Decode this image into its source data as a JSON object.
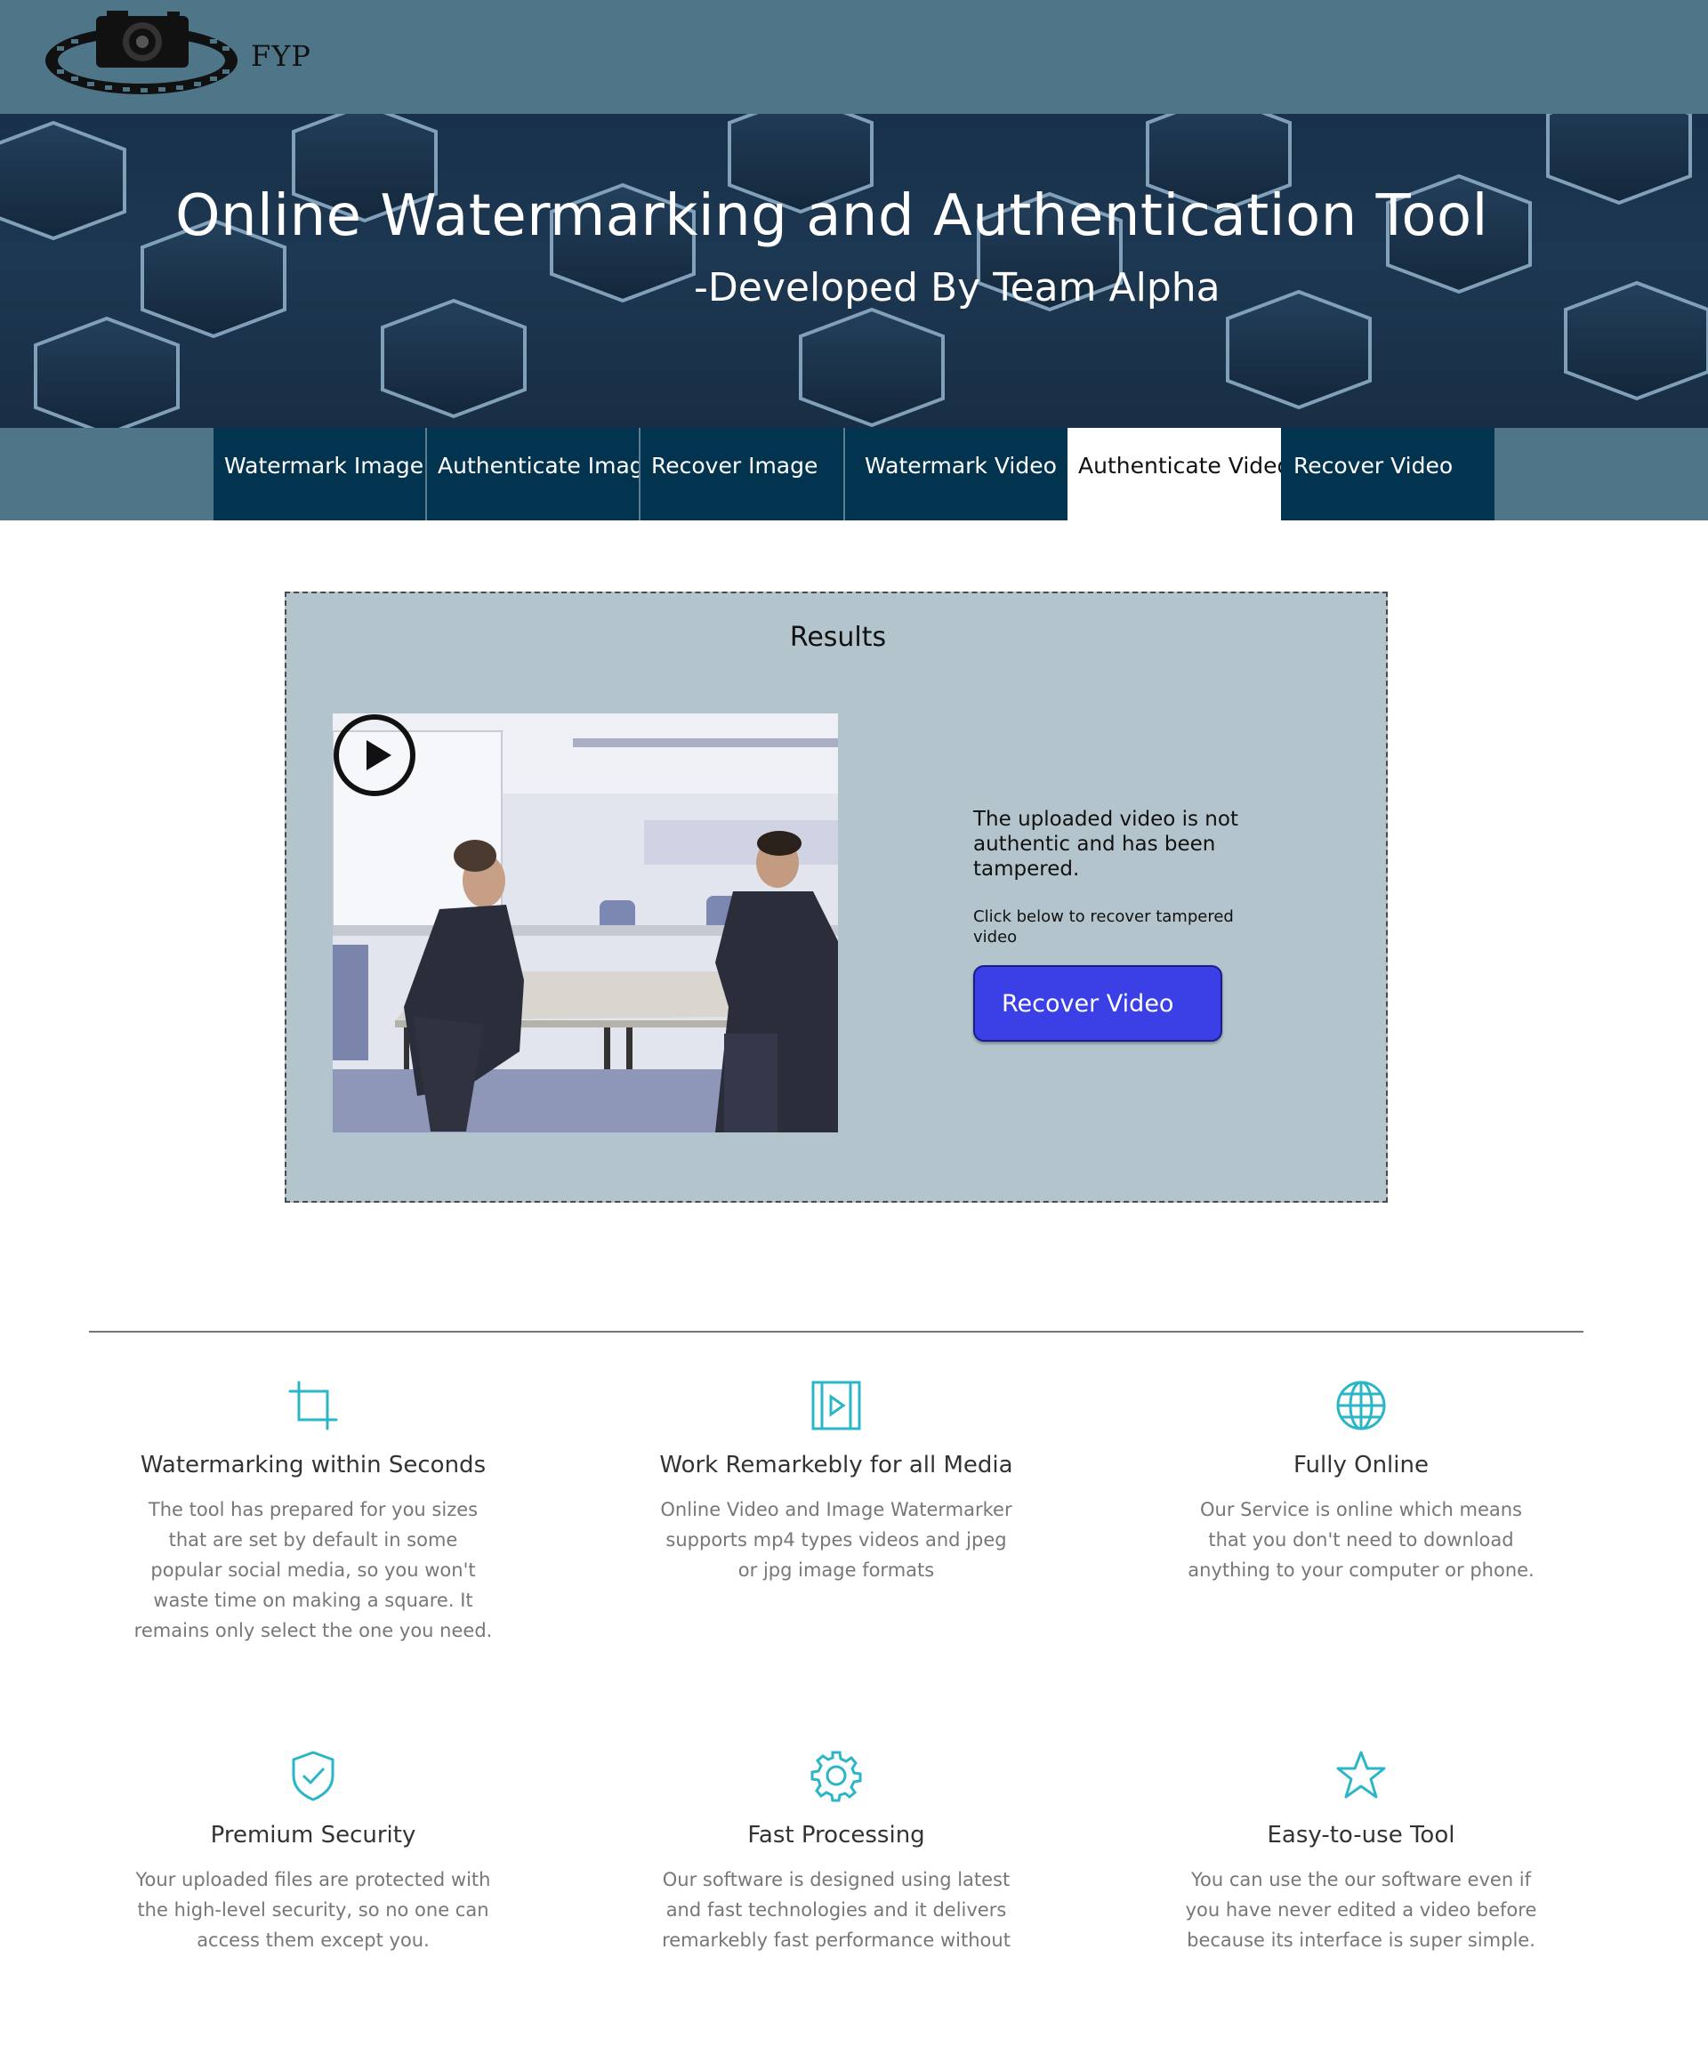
{
  "header": {
    "logo_text": "FYP"
  },
  "hero": {
    "title": "Online Watermarking and Authentication Tool",
    "subtitle": "-Developed By Team Alpha"
  },
  "nav": {
    "tabs": [
      {
        "label": "Watermark Image"
      },
      {
        "label": "Authenticate Image"
      },
      {
        "label": "Recover Image"
      },
      {
        "label": "Watermark Video"
      },
      {
        "label": "Authenticate Video"
      },
      {
        "label": "Recover Video"
      }
    ],
    "active_tab": "Authenticate Video"
  },
  "results": {
    "title": "Results",
    "message": "The uploaded video is not authentic and has been tampered.",
    "instruction": "Click below to recover tampered video",
    "button_label": "Recover Video"
  },
  "features": [
    {
      "icon": "crop-icon",
      "title": "Watermarking within Seconds",
      "text": "The tool has prepared for you sizes that are set by default in some popular social media, so you won't waste time on making a square. It remains only select the one you need."
    },
    {
      "icon": "video-frame-icon",
      "title": "Work Remarkebly for all Media",
      "text": "Online Video and Image Watermarker supports mp4 types videos and jpeg or jpg image formats"
    },
    {
      "icon": "globe-icon",
      "title": "Fully Online",
      "text": "Our Service is online which means that you don't need to download anything to your computer or phone."
    },
    {
      "icon": "shield-check-icon",
      "title": "Premium Security",
      "text": "Your uploaded files are protected with the high-level security, so no one can access them except you."
    },
    {
      "icon": "gear-icon",
      "title": "Fast Processing",
      "text": "Our software is designed using latest and fast technologies and it delivers remarkebly fast performance without"
    },
    {
      "icon": "star-icon",
      "title": "Easy-to-use Tool",
      "text": "You can use the our software even if you have never edited a video before because its interface is super simple."
    }
  ],
  "colors": {
    "header_bg": "#4f7688",
    "tab_bg": "#03344f",
    "panel_bg": "#b3c4cc",
    "button_bg": "#3b3fe6",
    "icon_accent": "#2bb6c8"
  }
}
